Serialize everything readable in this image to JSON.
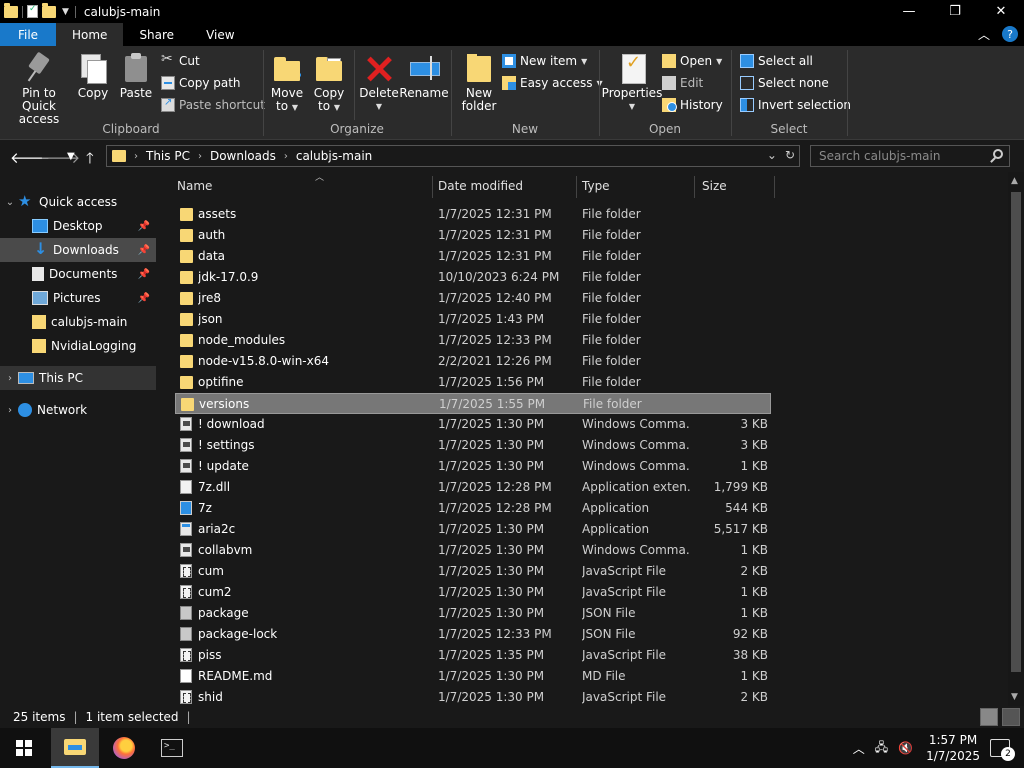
{
  "window": {
    "title": "calubjs-main",
    "controls": {
      "minimize": "—",
      "maximize": "❐",
      "close": "✕"
    }
  },
  "ribbon_tabs": [
    "File",
    "Home",
    "Share",
    "View"
  ],
  "ribbon": {
    "clipboard": {
      "label": "Clipboard",
      "pin_label_1": "Pin to Quick",
      "pin_label_2": "access",
      "copy": "Copy",
      "paste": "Paste",
      "cut": "Cut",
      "copy_path": "Copy path",
      "paste_shortcut": "Paste shortcut"
    },
    "organize": {
      "label": "Organize",
      "move_1": "Move",
      "move_2": "to",
      "copy_1": "Copy",
      "copy_2": "to",
      "delete": "Delete",
      "rename": "Rename"
    },
    "new": {
      "label": "New",
      "new_folder_1": "New",
      "new_folder_2": "folder",
      "new_item": "New item",
      "easy_access": "Easy access"
    },
    "open": {
      "label": "Open",
      "properties": "Properties",
      "open": "Open",
      "edit": "Edit",
      "history": "History"
    },
    "select": {
      "label": "Select",
      "select_all": "Select all",
      "select_none": "Select none",
      "invert": "Invert selection"
    }
  },
  "address": {
    "crumbs": [
      "This PC",
      "Downloads",
      "calubjs-main"
    ],
    "search_placeholder": "Search calubjs-main"
  },
  "nav_pane": {
    "quick_access": "Quick access",
    "items": [
      {
        "label": "Desktop",
        "pinned": true
      },
      {
        "label": "Downloads",
        "pinned": true
      },
      {
        "label": "Documents",
        "pinned": true
      },
      {
        "label": "Pictures",
        "pinned": true
      },
      {
        "label": "calubjs-main",
        "pinned": false
      },
      {
        "label": "NvidiaLogging",
        "pinned": false
      }
    ],
    "this_pc": "This PC",
    "network": "Network"
  },
  "columns": {
    "name": "Name",
    "date": "Date modified",
    "type": "Type",
    "size": "Size"
  },
  "files": [
    {
      "name": "assets",
      "date": "1/7/2025 12:31 PM",
      "type": "File folder",
      "size": "",
      "icon": "folder"
    },
    {
      "name": "auth",
      "date": "1/7/2025 12:31 PM",
      "type": "File folder",
      "size": "",
      "icon": "folder"
    },
    {
      "name": "data",
      "date": "1/7/2025 12:31 PM",
      "type": "File folder",
      "size": "",
      "icon": "folder"
    },
    {
      "name": "jdk-17.0.9",
      "date": "10/10/2023 6:24 PM",
      "type": "File folder",
      "size": "",
      "icon": "folder"
    },
    {
      "name": "jre8",
      "date": "1/7/2025 12:40 PM",
      "type": "File folder",
      "size": "",
      "icon": "folder"
    },
    {
      "name": "json",
      "date": "1/7/2025 1:43 PM",
      "type": "File folder",
      "size": "",
      "icon": "folder"
    },
    {
      "name": "node_modules",
      "date": "1/7/2025 12:33 PM",
      "type": "File folder",
      "size": "",
      "icon": "folder"
    },
    {
      "name": "node-v15.8.0-win-x64",
      "date": "2/2/2021 12:26 PM",
      "type": "File folder",
      "size": "",
      "icon": "folder"
    },
    {
      "name": "optifine",
      "date": "1/7/2025 1:56 PM",
      "type": "File folder",
      "size": "",
      "icon": "folder"
    },
    {
      "name": "versions",
      "date": "1/7/2025 1:55 PM",
      "type": "File folder",
      "size": "",
      "icon": "folder",
      "selected": true
    },
    {
      "name": "! download",
      "date": "1/7/2025 1:30 PM",
      "type": "Windows Comma...",
      "size": "3 KB",
      "icon": "cmd"
    },
    {
      "name": "! settings",
      "date": "1/7/2025 1:30 PM",
      "type": "Windows Comma...",
      "size": "3 KB",
      "icon": "cmd"
    },
    {
      "name": "! update",
      "date": "1/7/2025 1:30 PM",
      "type": "Windows Comma...",
      "size": "1 KB",
      "icon": "cmd"
    },
    {
      "name": "7z.dll",
      "date": "1/7/2025 12:28 PM",
      "type": "Application exten...",
      "size": "1,799 KB",
      "icon": "dll"
    },
    {
      "name": "7z",
      "date": "1/7/2025 12:28 PM",
      "type": "Application",
      "size": "544 KB",
      "icon": "app2"
    },
    {
      "name": "aria2c",
      "date": "1/7/2025 1:30 PM",
      "type": "Application",
      "size": "5,517 KB",
      "icon": "app"
    },
    {
      "name": "collabvm",
      "date": "1/7/2025 1:30 PM",
      "type": "Windows Comma...",
      "size": "1 KB",
      "icon": "cmd"
    },
    {
      "name": "cum",
      "date": "1/7/2025 1:30 PM",
      "type": "JavaScript File",
      "size": "2 KB",
      "icon": "js"
    },
    {
      "name": "cum2",
      "date": "1/7/2025 1:30 PM",
      "type": "JavaScript File",
      "size": "1 KB",
      "icon": "js"
    },
    {
      "name": "package",
      "date": "1/7/2025 1:30 PM",
      "type": "JSON File",
      "size": "1 KB",
      "icon": "json"
    },
    {
      "name": "package-lock",
      "date": "1/7/2025 12:33 PM",
      "type": "JSON File",
      "size": "92 KB",
      "icon": "json"
    },
    {
      "name": "piss",
      "date": "1/7/2025 1:35 PM",
      "type": "JavaScript File",
      "size": "38 KB",
      "icon": "js"
    },
    {
      "name": "README.md",
      "date": "1/7/2025 1:30 PM",
      "type": "MD File",
      "size": "1 KB",
      "icon": "md"
    },
    {
      "name": "shid",
      "date": "1/7/2025 1:30 PM",
      "type": "JavaScript File",
      "size": "2 KB",
      "icon": "js"
    }
  ],
  "status": {
    "items": "25 items",
    "selected": "1 item selected"
  },
  "taskbar": {
    "time": "1:57 PM",
    "date": "1/7/2025",
    "notifications": "2"
  },
  "colors": {
    "accent": "#1979ca",
    "folder": "#f8d775",
    "selection": "#777777"
  }
}
